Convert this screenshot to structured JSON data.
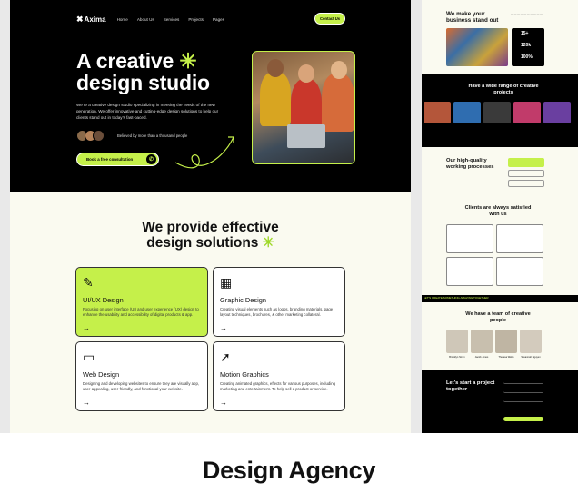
{
  "nav": {
    "logo": "Axima",
    "links": [
      "Home",
      "About Us",
      "Services",
      "Projects",
      "Pages"
    ],
    "cta": "Contact Us"
  },
  "hero": {
    "title_line1": "A creative",
    "title_line2": "design studio",
    "description": "We’re a creative design studio specializing in meeting the needs of the new generation. We offer innovative and cutting-edge design solutions to help our clients stand out in today’s fast-paced.",
    "trust_text": "Believed by more than a thousand people",
    "cta": "Book a free consultation"
  },
  "services": {
    "title_line1": "We provide effective",
    "title_line2": "design solutions",
    "cards": [
      {
        "title": "UI/UX Design",
        "desc": "Focusing on user interface (UI) and user experience (UX) design to enhance the usability and accessibility of digital products & app.",
        "icon": "pen-tool-icon"
      },
      {
        "title": "Graphic Design",
        "desc": "Creating visual elements such as logos, branding materials, page layout techniques, brochures, & other marketing collateral.",
        "icon": "graphic-icon"
      },
      {
        "title": "Web Design",
        "desc": "Designing and developing websites to ensure they are visually app, user-appealing, user-friendly, and functional your website.",
        "icon": "browser-icon"
      },
      {
        "title": "Motion Graphics",
        "desc": "Creating animated graphics, effects for various purposes, including marketing and entertainment. To help sell a product or service.",
        "icon": "cursor-icon"
      }
    ]
  },
  "strip": {
    "standout_title": "We make your business stand out",
    "stats": [
      "15+",
      "120k",
      "100%"
    ],
    "projects_title": "Have a wide range of creative projects",
    "process_title": "Our high-quality working processes",
    "clients_title": "Clients are always satisfied with us",
    "team_title": "We have a team of creative people",
    "team_names": [
      "Brooklyn Simm",
      "Jacob Jones",
      "Theresa Webb",
      "Savannah Nguyen"
    ],
    "ticker": "LET'S CREATE SOMETHING AMAZING TOGETHER",
    "contact_title": "Let's start a project together"
  },
  "caption": "Design Agency",
  "colors": {
    "accent": "#c5f04a",
    "dark": "#000000",
    "page_bg": "#fafaf0"
  }
}
